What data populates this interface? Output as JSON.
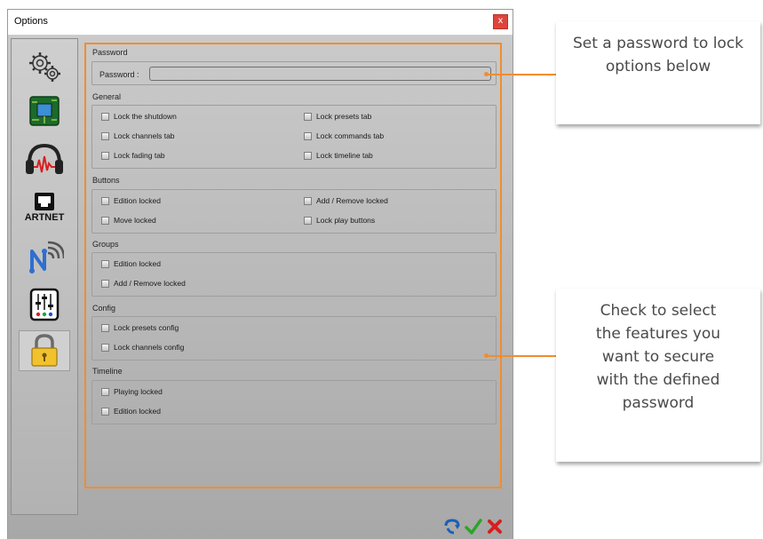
{
  "window": {
    "title": "Options",
    "close": "x"
  },
  "sidebar": {
    "artnet_label": "ARTNET"
  },
  "password": {
    "section": "Password",
    "label": "Password :",
    "value": ""
  },
  "general": {
    "section": "General",
    "items": [
      "Lock the shutdown",
      "Lock presets tab",
      "Lock channels tab",
      "Lock commands tab",
      "Lock fading tab",
      "Lock timeline tab"
    ]
  },
  "buttons": {
    "section": "Buttons",
    "items": [
      "Edition locked",
      "Add / Remove locked",
      "Move locked",
      "Lock play buttons"
    ]
  },
  "groups": {
    "section": "Groups",
    "items": [
      "Edition locked",
      "Add / Remove locked"
    ]
  },
  "config": {
    "section": "Config",
    "items": [
      "Lock presets config",
      "Lock channels config"
    ]
  },
  "timeline": {
    "section": "Timeline",
    "items": [
      "Playing locked",
      "Edition locked"
    ]
  },
  "callouts": {
    "top": "Set a password to lock options below",
    "bottom": "Check to select the features you want to secure with the defined password"
  },
  "colors": {
    "accent": "#f28c2f",
    "close": "#e0443a"
  }
}
